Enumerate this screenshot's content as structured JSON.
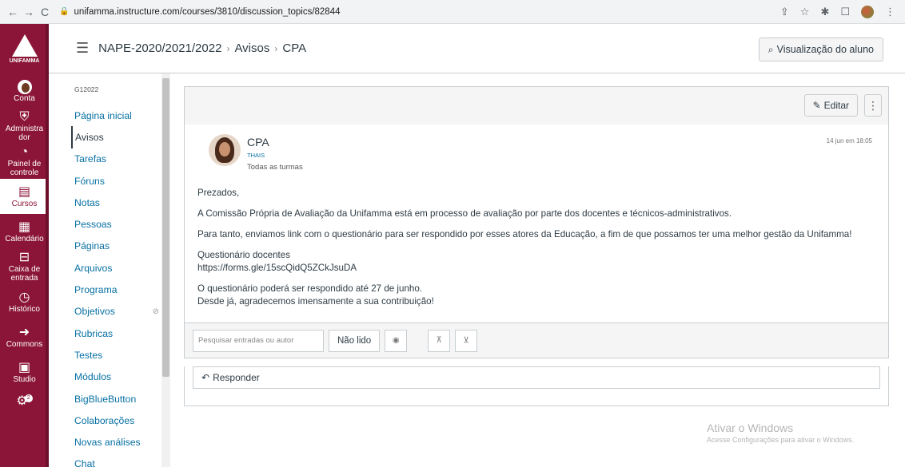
{
  "browser": {
    "url": "unifamma.instructure.com/courses/3810/discussion_topics/82844",
    "back": "←",
    "forward": "→",
    "reload": "C"
  },
  "global_nav": {
    "logo_text": "UNIFAMMA",
    "items": [
      {
        "label": "Conta",
        "icon": "user-avatar-icon"
      },
      {
        "label": "Administrador",
        "display": "Administra dor",
        "icon": "shield-icon"
      },
      {
        "label": "Painel de controle",
        "icon": "dashboard-icon"
      },
      {
        "label": "Cursos",
        "icon": "book-icon",
        "active": true
      },
      {
        "label": "Calendário",
        "icon": "calendar-icon"
      },
      {
        "label": "Caixa de entrada",
        "icon": "inbox-icon"
      },
      {
        "label": "Histórico",
        "icon": "clock-icon"
      },
      {
        "label": "Commons",
        "icon": "commons-icon"
      },
      {
        "label": "Studio",
        "icon": "studio-icon"
      },
      {
        "label": "",
        "icon": "help-icon",
        "badge": "2"
      }
    ]
  },
  "header": {
    "breadcrumbs": [
      "NAPE-2020/2021/2022",
      "Avisos",
      "CPA"
    ],
    "student_view_label": "Visualização do aluno"
  },
  "course_nav": {
    "term": "G12022",
    "items": [
      {
        "label": "Página inicial"
      },
      {
        "label": "Avisos",
        "active": true
      },
      {
        "label": "Tarefas"
      },
      {
        "label": "Fóruns"
      },
      {
        "label": "Notas"
      },
      {
        "label": "Pessoas"
      },
      {
        "label": "Páginas"
      },
      {
        "label": "Arquivos"
      },
      {
        "label": "Programa"
      },
      {
        "label": "Objetivos",
        "hidden": true
      },
      {
        "label": "Rubricas"
      },
      {
        "label": "Testes"
      },
      {
        "label": "Módulos"
      },
      {
        "label": "BigBlueButton"
      },
      {
        "label": "Colaborações"
      },
      {
        "label": "Novas análises"
      },
      {
        "label": "Chat"
      }
    ]
  },
  "announcement": {
    "edit_label": "Editar",
    "author": "CPA",
    "role": "THAIS",
    "section": "Todas as turmas",
    "timestamp": "14 jun em 18:05",
    "paragraphs": [
      "Prezados,",
      "A Comissão Própria de Avaliação da Unifamma está em processo de avaliação por parte dos docentes e técnicos-administrativos.",
      "Para tanto, enviamos link com o questionário para ser respondido por esses atores da Educação, a fim de que possamos ter uma melhor gestão da Unifamma!"
    ],
    "link_title": "Questionário docentes",
    "link_url": "https://forms.gle/15scQidQ5ZCkJsuDA",
    "deadline": "O questionário poderá ser respondido até 27 de junho.",
    "thanks": "Desde já, agradecemos imensamente a sua contribuição!"
  },
  "toolbar": {
    "search_placeholder": "Pesquisar entradas ou autor",
    "unread_label": "Não lido"
  },
  "reply_label": "Responder",
  "watermark": {
    "title": "Ativar o Windows",
    "subtitle": "Acesse Configurações para ativar o Windows."
  }
}
